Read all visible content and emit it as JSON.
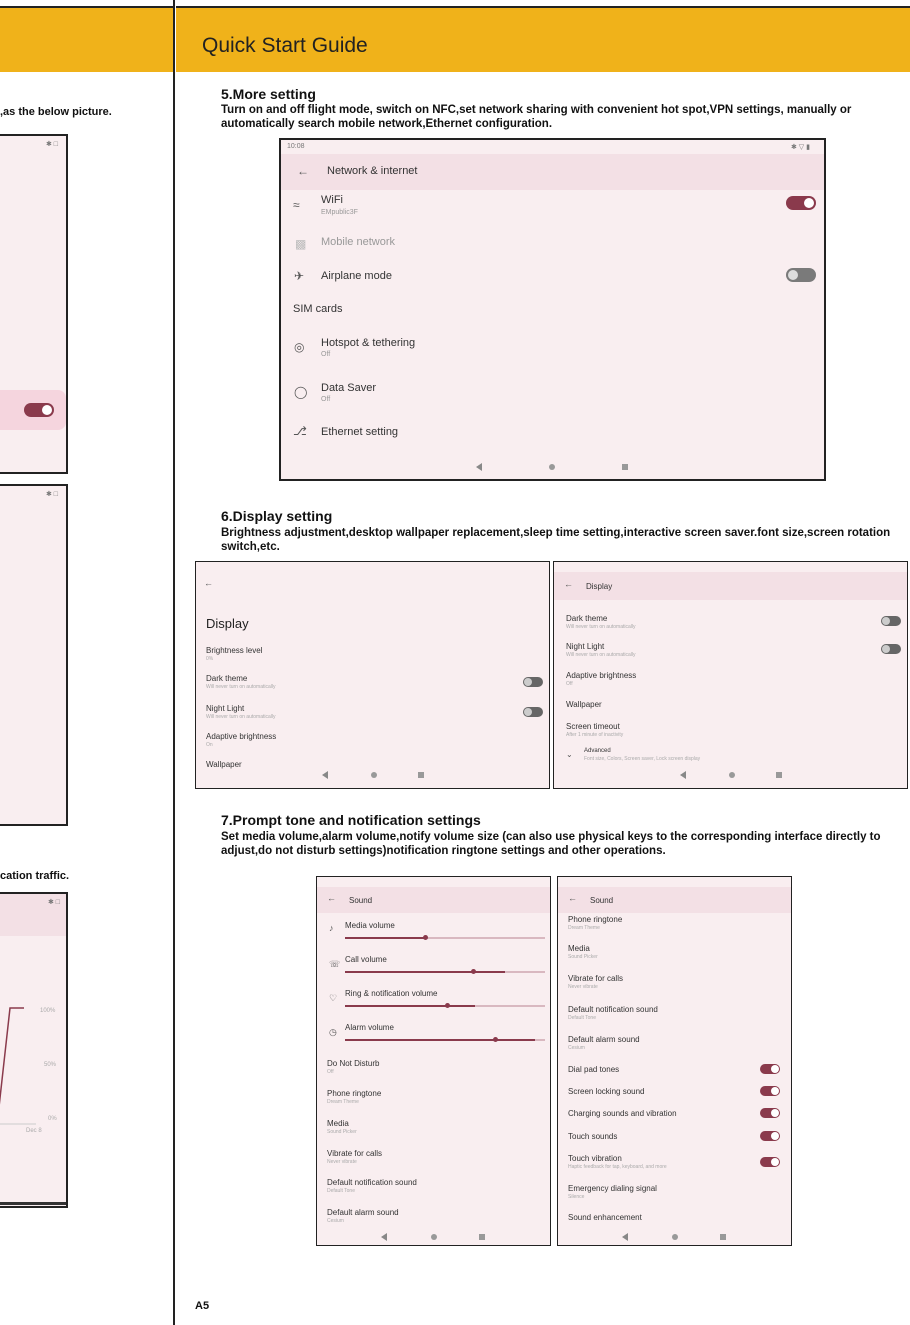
{
  "page": {
    "title": "Quick Start Guide",
    "page_number": "A5"
  },
  "left_fragments": {
    "caption_top": ",as the below picture.",
    "caption_traffic": "cation traffic.",
    "status_icons": "✱ □",
    "chart_labels": [
      "100%",
      "50%",
      "0%"
    ],
    "date_label": "Dec 8"
  },
  "section5": {
    "title": "5.More setting",
    "body": "Turn on and off flight mode, switch on NFC,set network sharing with convenient hot spot,VPN settings, manually or automatically search mobile network,Ethernet configuration.",
    "screen": {
      "time": "10:08",
      "status_icons": "✱ ▽ ▮",
      "header": "Network & internet",
      "items": [
        {
          "title": "WiFi",
          "sub": "EMpublic3F",
          "icon": "wifi-icon",
          "toggle": "on"
        },
        {
          "title": "Mobile network",
          "sub": "",
          "icon": "signal-icon",
          "toggle": "none"
        },
        {
          "title": "Airplane mode",
          "sub": "",
          "icon": "airplane-icon",
          "toggle": "off"
        },
        {
          "title": "SIM cards",
          "sub": "",
          "icon": "",
          "toggle": "none"
        },
        {
          "title": "Hotspot & tethering",
          "sub": "Off",
          "icon": "hotspot-icon",
          "toggle": "none"
        },
        {
          "title": "Data Saver",
          "sub": "Off",
          "icon": "data-saver-icon",
          "toggle": "none"
        },
        {
          "title": "Ethernet setting",
          "sub": "",
          "icon": "ethernet-icon",
          "toggle": "none"
        }
      ]
    }
  },
  "section6": {
    "title": "6.Display setting",
    "body": "Brightness adjustment,desktop wallpaper replacement,sleep time setting,interactive screen saver.font size,screen rotation switch,etc.",
    "screen_left": {
      "title": "Display",
      "items": [
        {
          "title": "Brightness level",
          "sub": "0%"
        },
        {
          "title": "Dark theme",
          "sub": "Will never turn on automatically"
        },
        {
          "title": "Night Light",
          "sub": "Will never turn on automatically"
        },
        {
          "title": "Adaptive brightness",
          "sub": "On"
        },
        {
          "title": "Wallpaper",
          "sub": ""
        }
      ]
    },
    "screen_right": {
      "header": "Display",
      "items": [
        {
          "title": "Dark theme",
          "sub": "Will never turn on automatically"
        },
        {
          "title": "Night Light",
          "sub": "Will never turn on automatically"
        },
        {
          "title": "Adaptive brightness",
          "sub": "Off"
        },
        {
          "title": "Wallpaper",
          "sub": ""
        },
        {
          "title": "Screen timeout",
          "sub": "After 1 minute of inactivity"
        },
        {
          "title": "Advanced",
          "sub": "Font size, Colors, Screen saver, Lock screen display"
        }
      ]
    }
  },
  "section7": {
    "title": "7.Prompt tone and notification settings",
    "body": "Set media volume,alarm volume,notify volume size (can also use physical keys to the corresponding interface directly to adjust,do not disturb settings)notification ringtone settings and other operations.",
    "screen_left": {
      "header": "Sound",
      "sliders": [
        {
          "title": "Media volume",
          "icon": "music-note-icon",
          "level": 0.4
        },
        {
          "title": "Call volume",
          "icon": "phone-icon",
          "level": 0.8
        },
        {
          "title": "Ring & notification volume",
          "icon": "bell-icon",
          "level": 0.65
        },
        {
          "title": "Alarm volume",
          "icon": "alarm-icon",
          "level": 0.95
        }
      ],
      "items": [
        {
          "title": "Do Not Disturb",
          "sub": "Off"
        },
        {
          "title": "Phone ringtone",
          "sub": "Dream Theme"
        },
        {
          "title": "Media",
          "sub": "Sound Picker"
        },
        {
          "title": "Vibrate for calls",
          "sub": "Never vibrate"
        },
        {
          "title": "Default notification sound",
          "sub": "Default Tone"
        },
        {
          "title": "Default alarm sound",
          "sub": "Cesium"
        }
      ]
    },
    "screen_right": {
      "header": "Sound",
      "items": [
        {
          "title": "Phone ringtone",
          "sub": "Dream Theme",
          "toggle": "none"
        },
        {
          "title": "Media",
          "sub": "Sound Picker",
          "toggle": "none"
        },
        {
          "title": "Vibrate for calls",
          "sub": "Never vibrate",
          "toggle": "none"
        },
        {
          "title": "Default notification sound",
          "sub": "Default Tone",
          "toggle": "none"
        },
        {
          "title": "Default alarm sound",
          "sub": "Cesium",
          "toggle": "none"
        },
        {
          "title": "Dial pad tones",
          "sub": "",
          "toggle": "on"
        },
        {
          "title": "Screen locking sound",
          "sub": "",
          "toggle": "on"
        },
        {
          "title": "Charging sounds and vibration",
          "sub": "",
          "toggle": "on"
        },
        {
          "title": "Touch sounds",
          "sub": "",
          "toggle": "on"
        },
        {
          "title": "Touch vibration",
          "sub": "Haptic feedback for tap, keyboard, and more",
          "toggle": "on"
        },
        {
          "title": "Emergency dialing signal",
          "sub": "Silence",
          "toggle": "none"
        },
        {
          "title": "Sound enhancement",
          "sub": "",
          "toggle": "none"
        }
      ]
    }
  },
  "colors": {
    "band": "#f0b21a",
    "accent": "#8a3a4c",
    "screen_bg": "#f9eef0"
  }
}
